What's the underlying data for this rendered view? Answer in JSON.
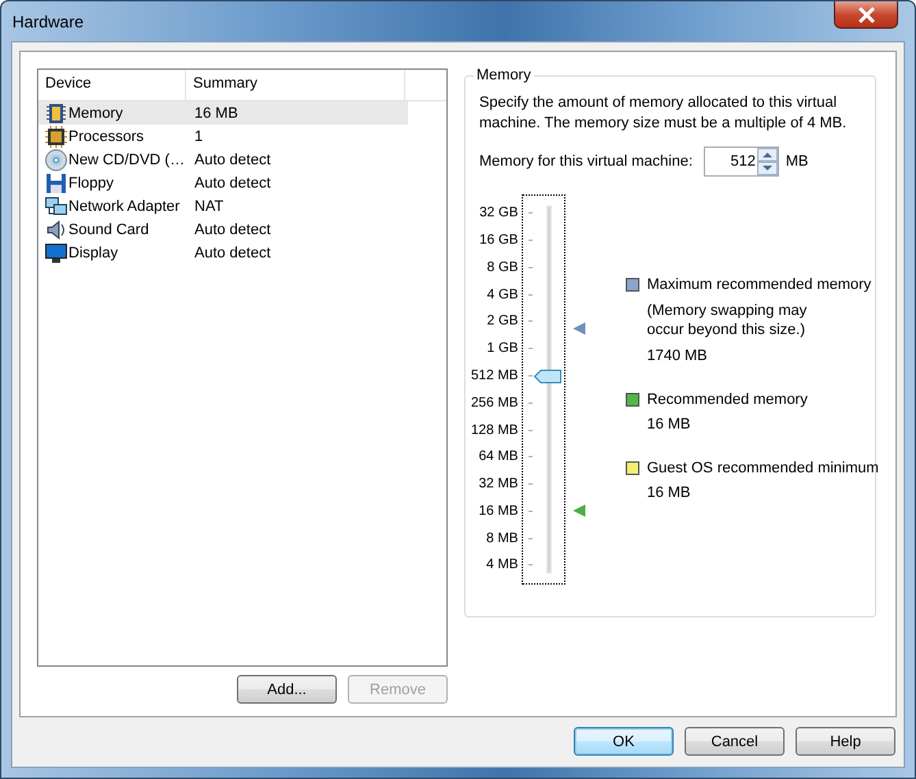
{
  "window": {
    "title": "Hardware"
  },
  "device_list": {
    "columns": [
      "Device",
      "Summary"
    ],
    "rows": [
      {
        "kind": "memory",
        "device": "Memory",
        "summary": "16 MB",
        "selected": true
      },
      {
        "kind": "processor",
        "device": "Processors",
        "summary": "1",
        "selected": false
      },
      {
        "kind": "disc",
        "device": "New CD/DVD (…",
        "summary": "Auto detect",
        "selected": false
      },
      {
        "kind": "floppy",
        "device": "Floppy",
        "summary": "Auto detect",
        "selected": false
      },
      {
        "kind": "network",
        "device": "Network Adapter",
        "summary": "NAT",
        "selected": false
      },
      {
        "kind": "sound",
        "device": "Sound Card",
        "summary": "Auto detect",
        "selected": false
      },
      {
        "kind": "display",
        "device": "Display",
        "summary": "Auto detect",
        "selected": false
      }
    ]
  },
  "list_buttons": [
    {
      "label": "Add...",
      "disabled": false
    },
    {
      "label": "Remove",
      "disabled": true
    }
  ],
  "memory": {
    "group_title": "Memory",
    "description": "Specify the amount of memory allocated to this virtual machine. The memory size must be a multiple of 4 MB.",
    "field_label": "Memory for this virtual machine:",
    "value": "512",
    "unit": "MB",
    "scale": [
      "32 GB",
      "16 GB",
      "8 GB",
      "4 GB",
      "2 GB",
      "1 GB",
      "512 MB",
      "256 MB",
      "128 MB",
      "64 MB",
      "32 MB",
      "16 MB",
      "8 MB",
      "4 MB"
    ],
    "slider": {
      "level": 0.538
    },
    "markers": [
      {
        "color": "#6f8fc0",
        "level": 0.674
      },
      {
        "color": "#4cb040",
        "level": 0.154
      }
    ],
    "legend": [
      {
        "color": "#8aa4cc",
        "label": "Maximum recommended memory",
        "note": "(Memory swapping may occur beyond this size.)",
        "value": "1740 MB"
      },
      {
        "color": "#50b848",
        "label": "Recommended memory",
        "value": "16 MB"
      },
      {
        "color": "#f2ef70",
        "label": "Guest OS recommended minimum",
        "value": "16 MB"
      }
    ]
  },
  "dialog_buttons": [
    {
      "label": "OK",
      "default": true
    },
    {
      "label": "Cancel",
      "default": false
    },
    {
      "label": "Help",
      "default": false
    }
  ]
}
